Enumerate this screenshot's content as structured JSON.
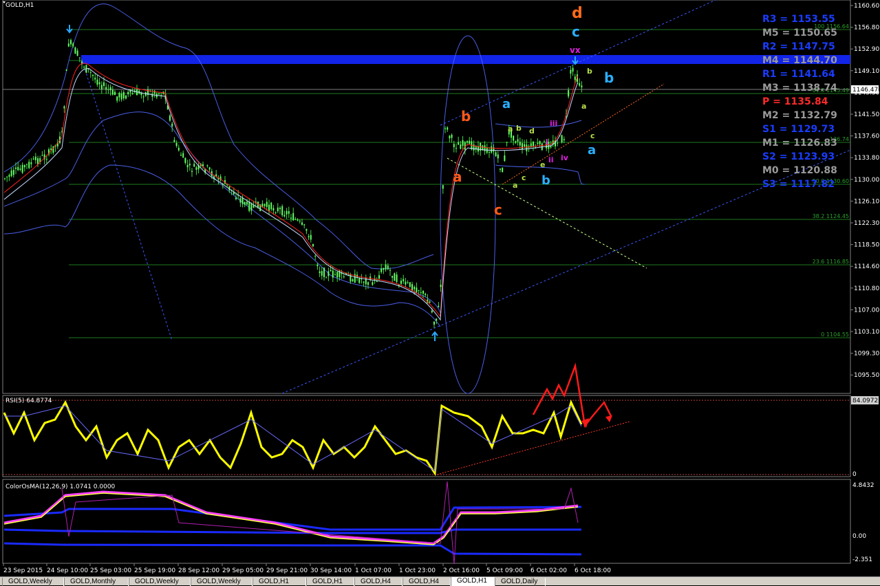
{
  "window": {
    "title": "GOLD,H1"
  },
  "main_chart": {
    "symbol_label": "GOLD,H1",
    "price_ticks": [
      "1160.60",
      "1156.80",
      "1152.90",
      "1149.10",
      "1145.30",
      "1141.50",
      "1137.60",
      "1133.80",
      "1130.00",
      "1126.10",
      "1122.30",
      "1118.50",
      "1114.60",
      "1110.80",
      "1107.00",
      "1103.10",
      "1099.30",
      "1095.50"
    ],
    "current_price": "1146.47",
    "fib_levels": [
      {
        "label": "100 1156.64"
      },
      {
        "label": "61.8 1150.70"
      },
      {
        "label": "61.8 1145.49"
      },
      {
        "label": "136.74"
      },
      {
        "label": "50.0 1130.60"
      },
      {
        "label": "38.2 1124.45"
      },
      {
        "label": "23.6 1116.85"
      },
      {
        "label": "0 1104.55"
      }
    ],
    "pivots": [
      {
        "label": "R3 = 1153.55",
        "color": "#1a3cff"
      },
      {
        "label": "M5 = 1150.65",
        "color": "#9a9a9a"
      },
      {
        "label": "R2 = 1147.75",
        "color": "#1a3cff"
      },
      {
        "label": "M4 = 1144.70",
        "color": "#9a9a9a"
      },
      {
        "label": "R1 = 1141.64",
        "color": "#1a3cff"
      },
      {
        "label": "M3 = 1138.74",
        "color": "#9a9a9a"
      },
      {
        "label": "P   = 1135.84",
        "color": "#ff2a2a"
      },
      {
        "label": "M2 = 1132.79",
        "color": "#9a9a9a"
      },
      {
        "label": "S1 = 1129.73",
        "color": "#1a3cff"
      },
      {
        "label": "M1 = 1126.83",
        "color": "#9a9a9a"
      },
      {
        "label": "S2 = 1123.93",
        "color": "#1a3cff"
      },
      {
        "label": "M0 = 1120.88",
        "color": "#9a9a9a"
      },
      {
        "label": "S3 = 1117.82",
        "color": "#1a3cff"
      }
    ],
    "wave_labels": {
      "d_big": "d",
      "c_big": "c",
      "vx": "vx",
      "b_right": "b",
      "b_orange": "b",
      "a_orange": "a",
      "c_orange": "c",
      "a_cyan": "a",
      "b_cyan": "b",
      "a_cyan_right": "a",
      "a_small": "a",
      "b_small": "b",
      "c_small": "c",
      "d_small": "d",
      "e_small": "e",
      "b_small2": "b",
      "a_small2": "a",
      "c_small2": "c",
      "i": "i",
      "ii": "ii",
      "iii": "iii",
      "iv": "iv"
    }
  },
  "rsi_panel": {
    "label": "RSI(5) 64.8774",
    "value_tag": "84.0972",
    "zero": "0"
  },
  "osma_panel": {
    "label": "ColorOsMA(12,26,9) 1.0741 0.0000",
    "top": "4.8432",
    "mid": "0.00",
    "bottom": "-2.351"
  },
  "time_axis": [
    "23 Sep 2015",
    "24 Sep 10:00",
    "25 Sep 03:00",
    "25 Sep 19:00",
    "28 Sep 12:00",
    "29 Sep 05:00",
    "29 Sep 21:00",
    "30 Sep 14:00",
    "1 Oct 07:00",
    "1 Oct 23:00",
    "2 Oct 16:00",
    "5 Oct 09:00",
    "6 Oct 02:00",
    "6 Oct 18:00"
  ],
  "tabs": [
    {
      "label": "GOLD,Weekly",
      "active": false
    },
    {
      "label": "GOLD,Monthly",
      "active": false
    },
    {
      "label": "GOLD,Weekly",
      "active": false
    },
    {
      "label": "GOLD,Weekly",
      "active": false
    },
    {
      "label": "GOLD,H1",
      "active": false
    },
    {
      "label": "GOLD,H1",
      "active": false
    },
    {
      "label": "GOLD,H4",
      "active": false
    },
    {
      "label": "GOLD,H4",
      "active": false
    },
    {
      "label": "GOLD,H1",
      "active": true
    },
    {
      "label": "GOLD,Daily",
      "active": false
    }
  ]
}
